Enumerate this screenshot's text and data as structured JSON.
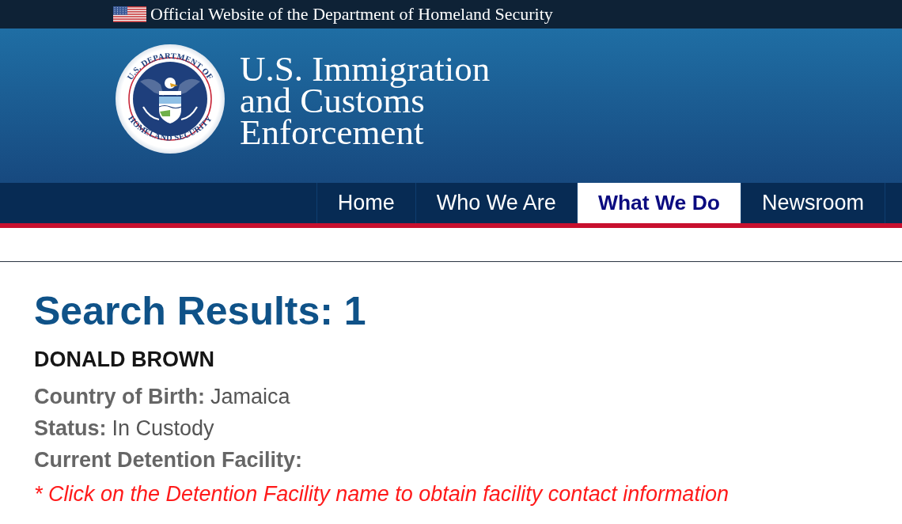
{
  "banner": {
    "text": "Official Website of the Department of Homeland Security"
  },
  "header": {
    "seal": {
      "top_text": "U.S. DEPARTMENT OF",
      "bottom_text": "HOMELAND SECURITY"
    },
    "agency_name_lines": [
      "U.S. Immigration",
      "and Customs",
      "Enforcement"
    ]
  },
  "nav": {
    "tabs": [
      {
        "label": "Home",
        "selected": false
      },
      {
        "label": "Who We Are",
        "selected": false
      },
      {
        "label": "What We Do",
        "selected": true
      },
      {
        "label": "Newsroom",
        "selected": false
      }
    ]
  },
  "results": {
    "title": "Search Results: 1",
    "name": "DONALD BROWN",
    "fields": [
      {
        "label": "Country of Birth:",
        "value": "Jamaica"
      },
      {
        "label": "Status:",
        "value": "In Custody"
      },
      {
        "label": "Current Detention Facility:"
      }
    ],
    "note": "* Click on the Detention Facility name to obtain facility contact information"
  }
}
